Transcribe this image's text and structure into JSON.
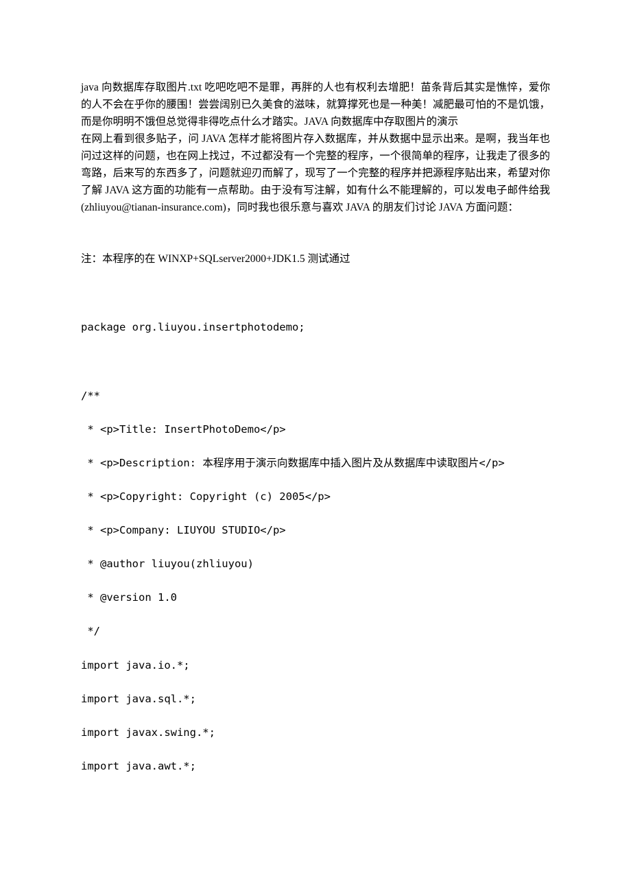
{
  "intro": {
    "p1": "java 向数据库存取图片.txt 吃吧吃吧不是罪，再胖的人也有权利去增肥！苗条背后其实是憔悴，爱你的人不会在乎你的腰围！尝尝阔别已久美食的滋味，就算撑死也是一种美！减肥最可怕的不是饥饿，而是你明明不饿但总觉得非得吃点什么才踏实。JAVA 向数据库中存取图片的演示",
    "p2": "在网上看到很多贴子，问 JAVA 怎样才能将图片存入数据库，并从数据中显示出来。是啊，我当年也问过这样的问题，也在网上找过，不过都没有一个完整的程序，一个很简单的程序，让我走了很多的弯路，后来写的东西多了，问题就迎刃而解了，现写了一个完整的程序并把源程序贴出来，希望对你了解 JAVA 这方面的功能有一点帮助。由于没有写注解，如有什么不能理解的，可以发电子邮件给我(zhliuyou@tianan-insurance.com)，同时我也很乐意与喜欢 JAVA 的朋友们讨论 JAVA 方面问题："
  },
  "note": "注：本程序的在 WINXP+SQLserver2000+JDK1.5 测试通过",
  "pkg": "package org.liuyou.insertphotodemo;",
  "javadoc": {
    "open": "/**",
    "l1": " * <p>Title: InsertPhotoDemo</p>",
    "l2": " * <p>Description: 本程序用于演示向数据库中插入图片及从数据库中读取图片</p>",
    "l3": " * <p>Copyright: Copyright (c) 2005</p>",
    "l4": " * <p>Company: LIUYOU STUDIO</p>",
    "l5": " * @author liuyou(zhliuyou)",
    "l6": " * @version 1.0",
    "close": " */"
  },
  "imports": {
    "i1": "import java.io.*;",
    "i2": "import java.sql.*;",
    "i3": "import javax.swing.*;",
    "i4": "import java.awt.*;"
  }
}
